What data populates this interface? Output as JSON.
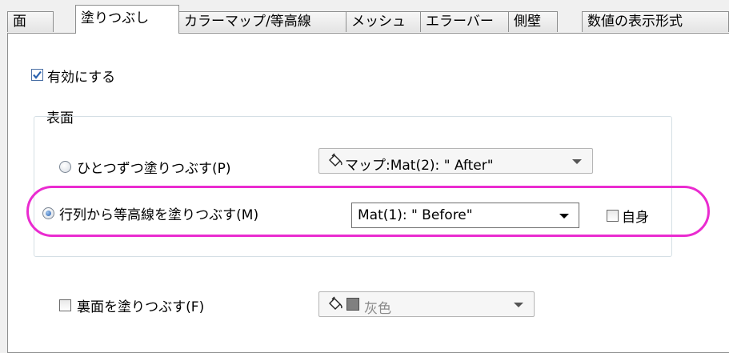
{
  "tabs": [
    {
      "label": "面",
      "active": false
    },
    {
      "label": "塗りつぶし",
      "active": true
    },
    {
      "label": "カラーマップ/等高線",
      "active": false
    },
    {
      "label": "メッシュ",
      "active": false
    },
    {
      "label": "エラーバー",
      "active": false
    },
    {
      "label": "側壁",
      "active": false
    },
    {
      "label": "数値の表示形式",
      "active": false
    }
  ],
  "enable": {
    "label": "有効にする",
    "checked": true
  },
  "surface_group": {
    "title": "表面",
    "option_each": {
      "label": "ひとつずつ塗りつぶす(P)",
      "selected": false
    },
    "option_each_combo": {
      "value": "マップ:Mat(2): \" After\"",
      "icon": "paint-bucket-icon"
    },
    "option_matrix": {
      "label": "行列から等高線を塗りつぶす(M)",
      "selected": true
    },
    "option_matrix_combo": {
      "value": "Mat(1): \" Before\""
    },
    "self": {
      "label": "自身",
      "checked": false
    }
  },
  "backface": {
    "label": "裏面を塗りつぶす(F)",
    "checked": false,
    "color_combo": {
      "value": "灰色",
      "swatch_color": "#808080",
      "icon": "paint-bucket-icon"
    }
  },
  "colors": {
    "highlight": "#ea2bd0",
    "check": "#2a62b0"
  }
}
